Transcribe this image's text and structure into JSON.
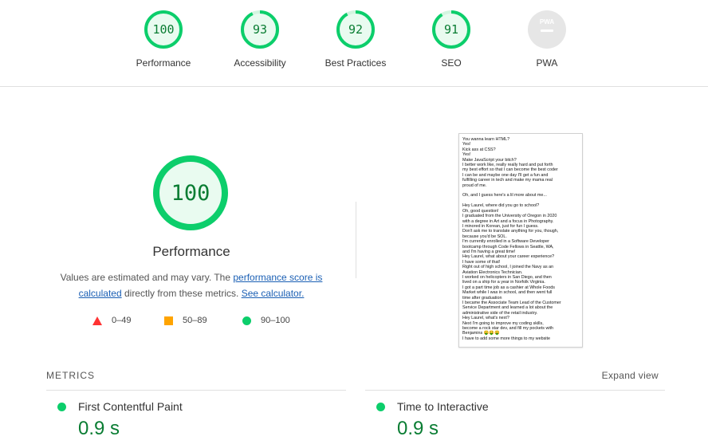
{
  "gauges": [
    {
      "score": "100",
      "label": "Performance",
      "value": 100
    },
    {
      "score": "93",
      "label": "Accessibility",
      "value": 93
    },
    {
      "score": "92",
      "label": "Best Practices",
      "value": 92
    },
    {
      "score": "91",
      "label": "SEO",
      "value": 91
    }
  ],
  "pwa": {
    "label": "PWA",
    "badge": "PWA"
  },
  "colors": {
    "pass": "#0cce6b",
    "pass_text": "#0a7d33",
    "fail": "#ff3333",
    "average": "#ffa400",
    "pass_bg": "#e9fbf0"
  },
  "main": {
    "score": "100",
    "title": "Performance",
    "desc_pre": "Values are estimated and may vary. The ",
    "desc_link": "performance score is calculated",
    "desc_mid": " directly from these metrics. ",
    "desc_link2": "See calculator."
  },
  "legend": [
    {
      "range": "0–49",
      "shape": "triangle-icon"
    },
    {
      "range": "50–89",
      "shape": "square-icon"
    },
    {
      "range": "90–100",
      "shape": "circle-icon"
    }
  ],
  "screenshot_lines": [
    "You wanna learn HTML?",
    "Yes!",
    "Kick ass at CSS?",
    "Yes!",
    "Make JavaScript your bitch?",
    "I better work like, really really hard and put forth",
    "my best effort so that I can become the best coder",
    "I can be and maybe one day I'll get a fun and",
    "fulfilling career in tech and make my mama real",
    "proud of me.",
    "",
    "Oh, and I guess here's a lil more about me...",
    "",
    "Hey Laurel, where did you go to school?",
    "Oh, good question!",
    "I graduated from the University of Oregon in 2020",
    "with a degree in Art and a focus in Photography.",
    "I minored in Korean, just for fun I guess.",
    "Don't ask me to translate anything for you, though,",
    "because you'd be SOL.",
    "I'm currently enrolled in a Software Developer",
    "bootcamp through Code Fellows in Seattle, WA,",
    "and I'm having a great time!",
    "Hey Laurel, what about your career experience?",
    "I have some of that!",
    "Right out of high school, I joined the Navy as an",
    "Aviation Electronics Technician.",
    "I worked on helicopters in San Diego, and then",
    "lived on a ship for a year in Norfolk Virginia.",
    "I got a part time job as a cashier at Whole Foods",
    "Market while I was in school, and then went full",
    "time after graduation",
    "I became the Associate Team Lead of the Customer",
    "Service Department and learned a lot about the",
    "administrative side of the retail industry.",
    "Hey Laurel, what's next?",
    "Next I'm going to improve my coding skills,",
    "become a rock star dev, and fill my pockets with",
    "Benjamins 🤑🤑🤑",
    "I have to add some more things to my website"
  ],
  "metrics": {
    "title": "METRICS",
    "expand": "Expand view",
    "items": [
      {
        "name": "First Contentful Paint",
        "value": "0.9 s"
      },
      {
        "name": "Time to Interactive",
        "value": "0.9 s"
      }
    ]
  }
}
